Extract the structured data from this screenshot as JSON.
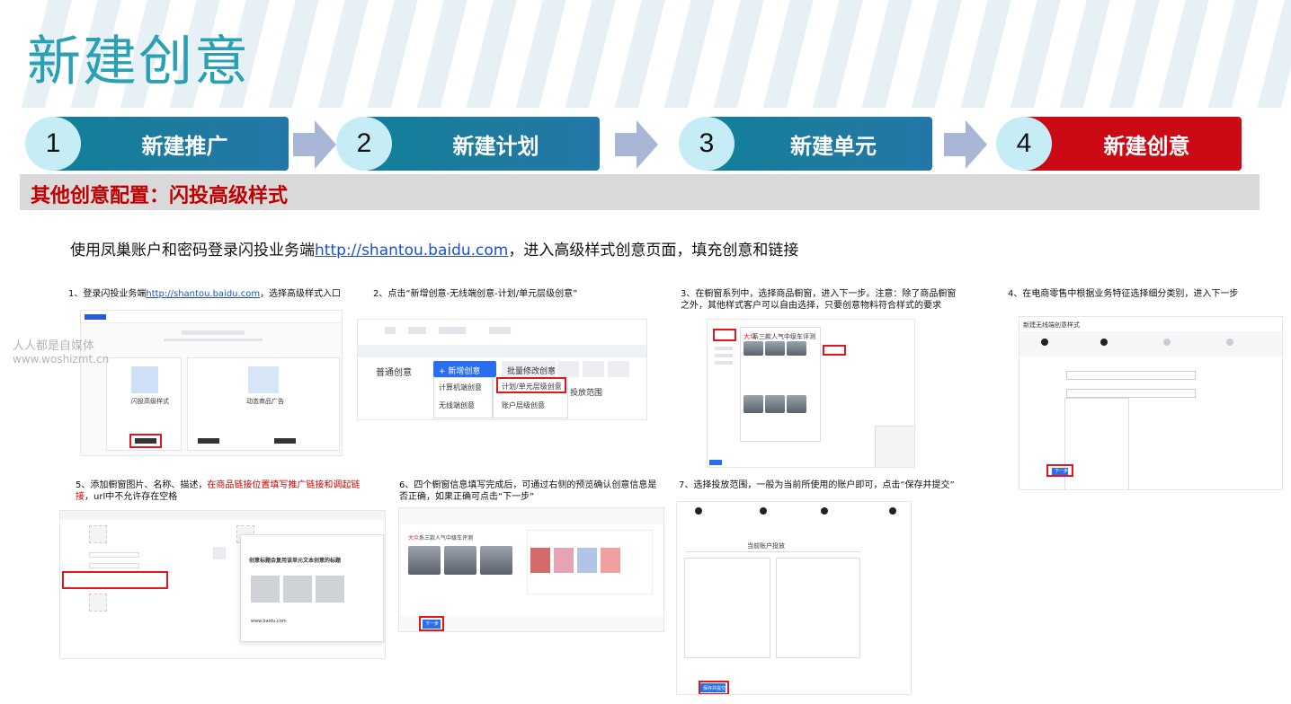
{
  "title": "新建创意",
  "steps": [
    {
      "num": "1",
      "label": "新建推广",
      "color": "#11809a"
    },
    {
      "num": "2",
      "label": "新建计划",
      "color": "#11809a"
    },
    {
      "num": "3",
      "label": "新建单元",
      "color": "#11809a"
    },
    {
      "num": "4",
      "label": "新建创意",
      "color": "#cc0a16"
    }
  ],
  "section": {
    "title": "其他创意配置：闪投高级样式"
  },
  "intro": {
    "before": "使用凤巢账户和密码登录闪投业务端",
    "link": "http://shantou.baidu.com",
    "after": "，进入高级样式创意页面，填充创意和链接"
  },
  "captions": {
    "c1_pre": "1、登录闪投业务端",
    "c1_link": "http://shantou.baidu.com",
    "c1_post": "，选择高级样式入口",
    "c2": "2、点击“新增创意-无线端创意-计划/单元层级创意”",
    "c3": "3、在橱窗系列中，选择商品橱窗，进入下一步。注意：除了商品橱窗之外，其他样式客户可以自由选择，只要创意物料符合样式的要求",
    "c4": "4、在电商零售中根据业务特征选择细分类别，进入下一步",
    "c5_pre": "5、添加橱窗图片、名称、描述，",
    "c5_red": "在商品链接位置填写推广链接和调起链接",
    "c5_post": "，url中不允许存在空格",
    "c6": "6、四个橱窗信息填写完成后，可通过右侧的预览确认创意信息是否正确，如果正确可点击“下一步”",
    "c7": "7、选择投放范围，一般为当前所使用的账户即可，点击“保存并提交”"
  },
  "screens": {
    "s1": {
      "card_left": "闪投高级样式",
      "card_right": "动态商品广告",
      "btn": "开始使用"
    },
    "s2": {
      "tab": "普通创意",
      "add_btn": "+ 新增创意",
      "batch": "批量修改创意",
      "pc": "计算机端创意",
      "wireless": "无线端创意",
      "plan_unit": "计划/单元层级创意",
      "account": "账户层级创意",
      "scope": "投放范围"
    },
    "s3": {
      "brand": "大众",
      "text": "系三款人气中级车评测"
    },
    "s4": {
      "header": "新建无线端创意样式",
      "next": "下一步"
    },
    "s5": {
      "preview_title": "创意标题会复用该单元文本创意的标题",
      "site": "www.baidu.com"
    },
    "s6": {
      "headline_brand": "大众",
      "headline": "系三款人气中级车评测",
      "next": "下一步"
    },
    "s7": {
      "panel": "当前账户投放",
      "save": "保存并提交"
    }
  },
  "watermark": {
    "line1": "人人都是自媒体",
    "line2": "www.woshizmt.cn"
  }
}
